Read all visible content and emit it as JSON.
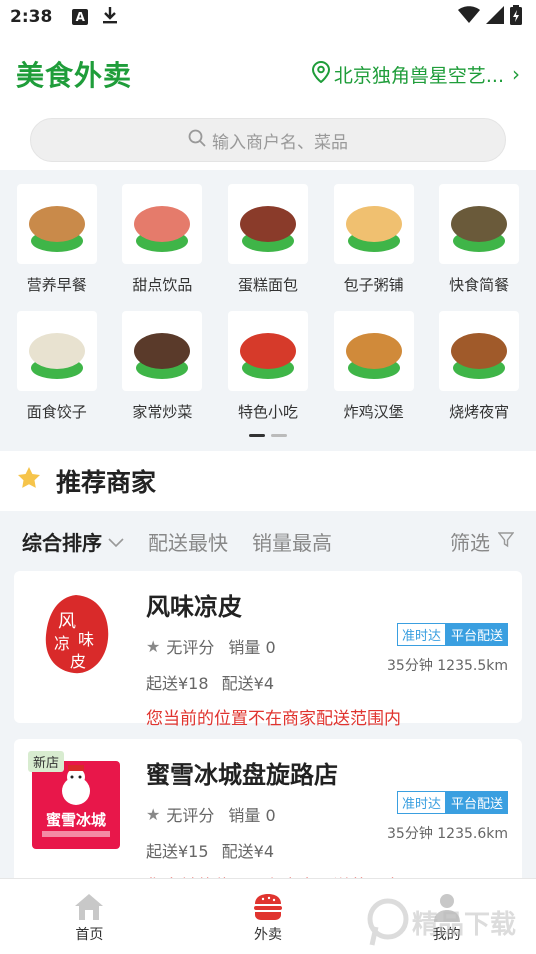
{
  "status_bar": {
    "time": "2:38",
    "a_icon": "A"
  },
  "header": {
    "brand": "美食外卖",
    "location": "北京独角兽星空艺...",
    "location_chevron": "›"
  },
  "search": {
    "placeholder": "输入商户名、菜品"
  },
  "categories": [
    {
      "label": "营养早餐",
      "icon": "breakfast-icon",
      "color": "#c98a4a"
    },
    {
      "label": "甜点饮品",
      "icon": "dessert-icon",
      "color": "#e57b6b"
    },
    {
      "label": "蛋糕面包",
      "icon": "cake-icon",
      "color": "#8a3b2a"
    },
    {
      "label": "包子粥铺",
      "icon": "bun-icon",
      "color": "#f0c070"
    },
    {
      "label": "快食简餐",
      "icon": "bento-icon",
      "color": "#6a5a3a"
    },
    {
      "label": "面食饺子",
      "icon": "dumpling-icon",
      "color": "#e8e2d0"
    },
    {
      "label": "家常炒菜",
      "icon": "stirfry-icon",
      "color": "#5a3a2a"
    },
    {
      "label": "特色小吃",
      "icon": "snack-icon",
      "color": "#d63a2a"
    },
    {
      "label": "炸鸡汉堡",
      "icon": "friedchicken-icon",
      "color": "#d08a3a"
    },
    {
      "label": "烧烤夜宵",
      "icon": "bbq-icon",
      "color": "#a05a2a"
    }
  ],
  "recommend": {
    "title": "推荐商家"
  },
  "sort": {
    "items": [
      "综合排序",
      "配送最快",
      "销量最高"
    ],
    "filter": "筛选"
  },
  "shops": [
    {
      "name": "风味凉皮",
      "logo_text": "风凉味皮",
      "rating": "无评分",
      "sales": "销量 0",
      "min_order": "起送¥18",
      "delivery_fee": "配送¥4",
      "tag_ontime": "准时达",
      "tag_platform": "平台配送",
      "distance": "35分钟 1235.5km",
      "warning": "您当前的位置不在商家配送范围内",
      "new_badge": ""
    },
    {
      "name": "蜜雪冰城盘旋路店",
      "logo_text": "蜜雪冰城",
      "rating": "无评分",
      "sales": "销量 0",
      "min_order": "起送¥15",
      "delivery_fee": "配送¥4",
      "tag_ontime": "准时达",
      "tag_platform": "平台配送",
      "distance": "35分钟 1235.6km",
      "warning": "您当前的位置不在商家配送范围内",
      "new_badge": "新店"
    }
  ],
  "tabbar": {
    "items": [
      {
        "label": "首页",
        "icon": "home-icon"
      },
      {
        "label": "外卖",
        "icon": "burger-icon"
      },
      {
        "label": "我的",
        "icon": "profile-icon"
      }
    ]
  },
  "watermark": "精品下载",
  "colors": {
    "brand": "#1f9d3a",
    "warning": "#e0342f",
    "tag_blue": "#3a9fe0",
    "plate_green": "#3fb548"
  }
}
